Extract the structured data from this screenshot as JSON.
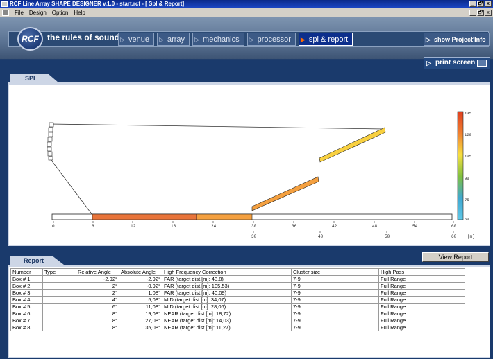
{
  "window": {
    "title": "RCF Line Array SHAPE DESIGNER v.1.0 - start.rcf - [ Spl & Report]",
    "min": "_",
    "max": "🗗",
    "close": "x"
  },
  "menu": {
    "items": [
      "File",
      "Design",
      "Option",
      "Help"
    ]
  },
  "header": {
    "logo_text": "RCF",
    "tagline": "the rules of sound",
    "tabs": [
      "venue",
      "array",
      "mechanics",
      "processor",
      "spl & report"
    ],
    "active_tab": "spl & report",
    "show_project": "show Project'Info"
  },
  "toolbar": {
    "print_screen": "print screen"
  },
  "spl": {
    "tab_label": "SPL",
    "x_ticks": [
      "0",
      "6",
      "12",
      "18",
      "24",
      "30",
      "36",
      "42",
      "48",
      "54",
      "60"
    ],
    "x_ticks_lower": [
      "0",
      "30",
      "40",
      "50",
      "60"
    ],
    "x_unit": "[m]",
    "scale_labels": [
      "135",
      "120",
      "105",
      "90",
      "75",
      "60"
    ],
    "colors": {
      "hot": "#e8743a",
      "warm": "#f4a040",
      "yellow": "#f8d840"
    }
  },
  "report": {
    "tab_label": "Report",
    "view_button": "View Report",
    "columns": [
      "Number",
      "Type",
      "Relative Angle",
      "Absolute Angle",
      "High Frequency Correction",
      "Cluster size",
      "High Pass"
    ],
    "rows": [
      [
        "Box # 1",
        "",
        "-2,92°",
        "-2,92°",
        "FAR (target dist.[m]: 43,8)",
        "7-9",
        "Full Range"
      ],
      [
        "Box # 2",
        "",
        "2°",
        "-0,92°",
        "FAR (target dist.[m]: 105,53)",
        "7-9",
        "Full Range"
      ],
      [
        "Box # 3",
        "",
        "2°",
        "1,08°",
        "FAR (target dist.[m]: 40,09)",
        "7-9",
        "Full Range"
      ],
      [
        "Box # 4",
        "",
        "4°",
        "5,08°",
        "MID (target dist.[m]: 34,07)",
        "7-9",
        "Full Range"
      ],
      [
        "Box # 5",
        "",
        "6°",
        "11,08°",
        "MID (target dist.[m]: 28,06)",
        "7-9",
        "Full Range"
      ],
      [
        "Box # 6",
        "",
        "8°",
        "19,08°",
        "NEAR (target dist.[m]: 18,72)",
        "7-9",
        "Full Range"
      ],
      [
        "Box # 7",
        "",
        "8°",
        "27,08°",
        "NEAR (target dist.[m]: 14,03)",
        "7-9",
        "Full Range"
      ],
      [
        "Box # 8",
        "",
        "8°",
        "35,08°",
        "NEAR (target dist.[m]: 11,27)",
        "7-9",
        "Full Range"
      ]
    ]
  }
}
